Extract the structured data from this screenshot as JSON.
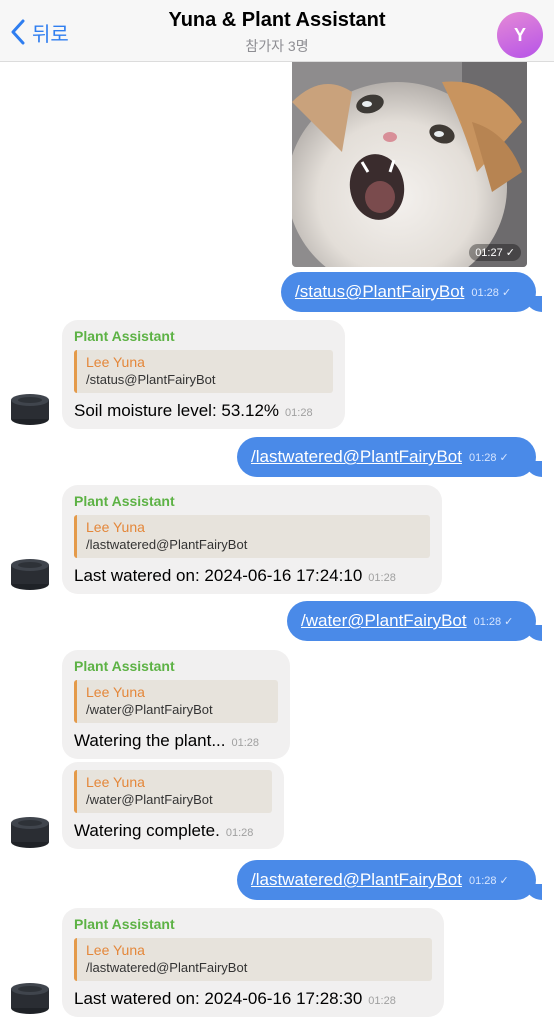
{
  "header": {
    "back_label": "뒤로",
    "title": "Yuna & Plant Assistant",
    "subtitle": "참가자 3명",
    "avatar_letter": "Y"
  },
  "messages": [
    {
      "type": "photo",
      "time": "01:27 ✓"
    },
    {
      "type": "out",
      "text": "/status@PlantFairyBot",
      "time": "01:28 ✓"
    },
    {
      "type": "in",
      "sender": "Plant Assistant",
      "quote_name": "Lee Yuna",
      "quote_text": "/status@PlantFairyBot",
      "text": "Soil moisture level: 53.12%",
      "time": "01:28"
    },
    {
      "type": "out",
      "text": "/lastwatered@PlantFairyBot",
      "time": "01:28 ✓"
    },
    {
      "type": "in",
      "sender": "Plant Assistant",
      "quote_name": "Lee Yuna",
      "quote_text": "/lastwatered@PlantFairyBot",
      "text": "Last watered on: 2024-06-16 17:24:10",
      "time": "01:28"
    },
    {
      "type": "out",
      "text": "/water@PlantFairyBot",
      "time": "01:28 ✓"
    },
    {
      "type": "in",
      "sender": "Plant Assistant",
      "quote_name": "Lee Yuna",
      "quote_text": "/water@PlantFairyBot",
      "text": "Watering the plant...",
      "time": "01:28"
    },
    {
      "type": "in",
      "sender": "",
      "quote_name": "Lee Yuna",
      "quote_text": "/water@PlantFairyBot",
      "text": "Watering complete.",
      "time": "01:28"
    },
    {
      "type": "out",
      "text": "/lastwatered@PlantFairyBot",
      "time": "01:28 ✓"
    },
    {
      "type": "in",
      "sender": "Plant Assistant",
      "quote_name": "Lee Yuna",
      "quote_text": "/lastwatered@PlantFairyBot",
      "text": "Last watered on: 2024-06-16 17:28:30",
      "time": "01:28"
    }
  ],
  "colors": {
    "outgoing_bubble": "#4a8ae8",
    "incoming_bubble": "#f1f0f0",
    "sender_name": "#5db245",
    "quote_accent": "#e49a4a",
    "header_link": "#2f7ef0"
  },
  "icons": [
    "back-chevron-icon",
    "read-check-icon",
    "bot-avatar-icon",
    "cat-photo"
  ]
}
